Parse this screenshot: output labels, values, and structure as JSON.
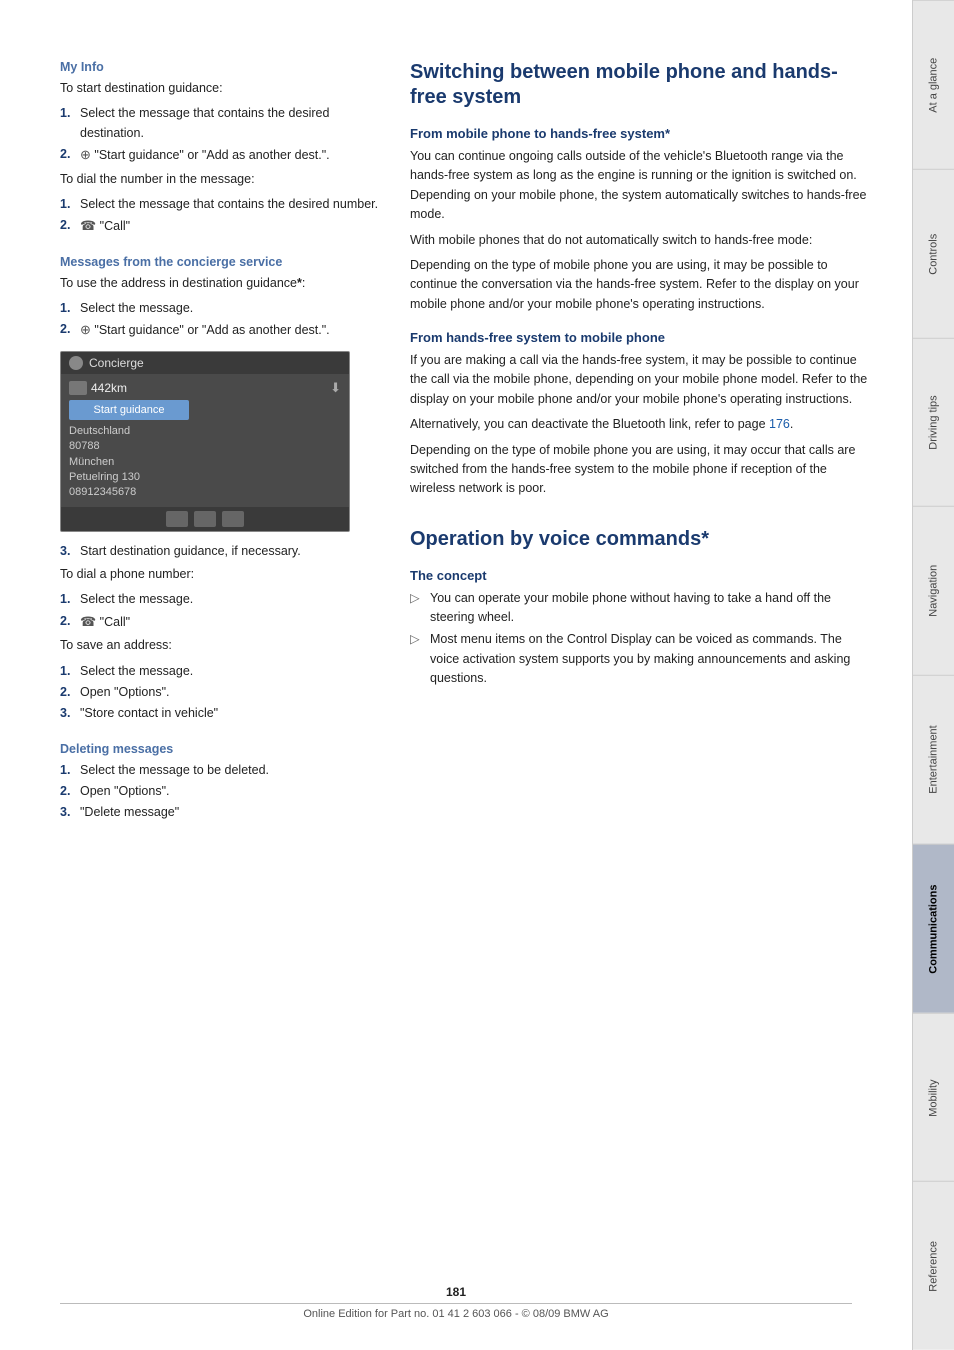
{
  "page": {
    "number": "181",
    "footer_text": "Online Edition for Part no. 01 41 2 603 066 - © 08/09 BMW AG"
  },
  "sidebar": {
    "tabs": [
      {
        "label": "At a glance",
        "active": false
      },
      {
        "label": "Controls",
        "active": false
      },
      {
        "label": "Driving tips",
        "active": false
      },
      {
        "label": "Navigation",
        "active": false
      },
      {
        "label": "Entertainment",
        "active": false
      },
      {
        "label": "Communications",
        "active": true
      },
      {
        "label": "Mobility",
        "active": false
      },
      {
        "label": "Reference",
        "active": false
      }
    ]
  },
  "left_column": {
    "my_info_heading": "My Info",
    "my_info_intro": "To start destination guidance:",
    "my_info_steps_1": [
      {
        "num": "1.",
        "text": "Select the message that contains the desired destination."
      },
      {
        "num": "2.",
        "text_prefix": "",
        "icon": "nav",
        "text": "\"Start guidance\" or \"Add as another dest.\"."
      }
    ],
    "dial_intro": "To dial the number in the message:",
    "dial_steps": [
      {
        "num": "1.",
        "text": "Select the message that contains the desired number."
      },
      {
        "num": "2.",
        "icon": "call",
        "text": "\"Call\""
      }
    ],
    "concierge_heading": "Messages from the concierge service",
    "concierge_intro": "To use the address in destination guidance*:",
    "concierge_steps_1": [
      {
        "num": "1.",
        "text": "Select the message."
      },
      {
        "num": "2.",
        "icon": "nav",
        "text": "\"Start guidance\" or \"Add as another dest.\"."
      }
    ],
    "screenshot": {
      "header_title": "Concierge",
      "km_value": "442km",
      "btn_label": "Start guidance",
      "address_lines": [
        "Deutschland",
        "80788",
        "München",
        "Petuelring 130",
        "08912345678"
      ]
    },
    "step_3": {
      "num": "3.",
      "text": "Start destination guidance, if necessary."
    },
    "dial_phone_intro": "To dial a phone number:",
    "dial_phone_steps": [
      {
        "num": "1.",
        "text": "Select the message."
      },
      {
        "num": "2.",
        "icon": "call",
        "text": "\"Call\""
      }
    ],
    "save_address_intro": "To save an address:",
    "save_address_steps": [
      {
        "num": "1.",
        "text": "Select the message."
      },
      {
        "num": "2.",
        "text": "Open \"Options\"."
      },
      {
        "num": "3.",
        "text": "\"Store contact in vehicle\""
      }
    ],
    "deleting_heading": "Deleting messages",
    "deleting_steps": [
      {
        "num": "1.",
        "text": "Select the message to be deleted."
      },
      {
        "num": "2.",
        "text": "Open \"Options\"."
      },
      {
        "num": "3.",
        "text": "\"Delete message\""
      }
    ]
  },
  "right_column": {
    "switching_heading": "Switching between mobile phone and hands-free system",
    "from_mobile_subheading": "From mobile phone to hands-free system*",
    "from_mobile_text_1": "You can continue ongoing calls outside of the vehicle's Bluetooth range via the hands-free system as long as the engine is running or the ignition is switched on. Depending on your mobile phone, the system automatically switches to hands-free mode.",
    "from_mobile_text_2": "With mobile phones that do not automatically switch to hands-free mode:",
    "from_mobile_text_3": "Depending on the type of mobile phone you are using, it may be possible to continue the conversation via the hands-free system. Refer to the display on your mobile phone and/or your mobile phone's operating instructions.",
    "from_handsfree_subheading": "From hands-free system to mobile phone",
    "from_handsfree_text_1": "If you are making a call via the hands-free system, it may be possible to continue the call via the mobile phone, depending on your mobile phone model. Refer to the display on your mobile phone and/or your mobile phone's operating instructions.",
    "from_handsfree_text_2": "Alternatively, you can deactivate the Bluetooth link, refer to page 176.",
    "from_handsfree_text_3": "Depending on the type of mobile phone you are using, it may occur that calls are switched from the hands-free system to the mobile phone if reception of the wireless network is poor.",
    "operation_heading": "Operation by voice commands*",
    "concept_subheading": "The concept",
    "concept_bullets": [
      "You can operate your mobile phone without having to take a hand off the steering wheel.",
      "Most menu items on the Control Display can be voiced as commands. The voice activation system supports you by making announcements and asking questions."
    ],
    "page_ref": "176"
  }
}
